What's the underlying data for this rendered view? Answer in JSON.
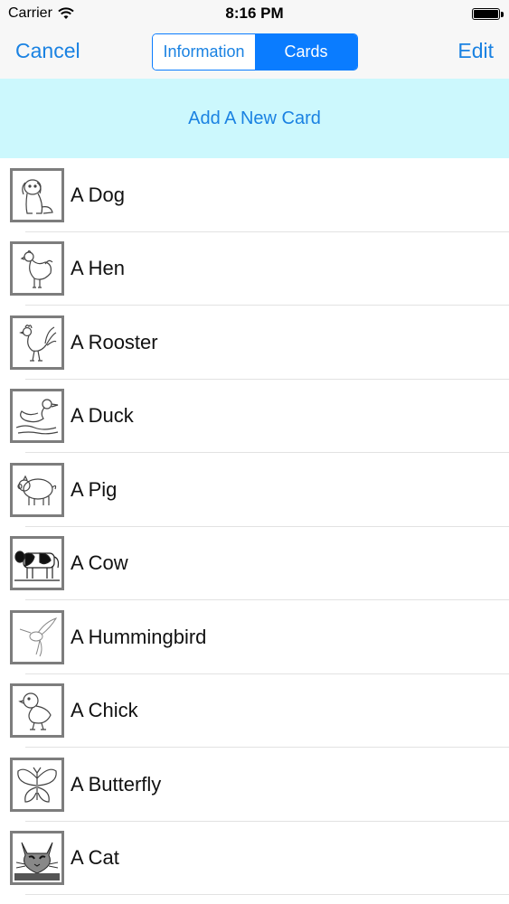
{
  "status_bar": {
    "carrier": "Carrier",
    "time": "8:16 PM"
  },
  "nav": {
    "cancel_label": "Cancel",
    "edit_label": "Edit",
    "segments": [
      "Information",
      "Cards"
    ],
    "selected_segment": "Cards"
  },
  "add_row": {
    "label": "Add A New Card"
  },
  "cards": [
    {
      "label": "A Dog",
      "icon": "dog-icon"
    },
    {
      "label": "A Hen",
      "icon": "hen-icon"
    },
    {
      "label": "A Rooster",
      "icon": "rooster-icon"
    },
    {
      "label": "A Duck",
      "icon": "duck-icon"
    },
    {
      "label": "A Pig",
      "icon": "pig-icon"
    },
    {
      "label": "A Cow",
      "icon": "cow-icon"
    },
    {
      "label": "A Hummingbird",
      "icon": "hummingbird-icon"
    },
    {
      "label": "A Chick",
      "icon": "chick-icon"
    },
    {
      "label": "A Butterfly",
      "icon": "butterfly-icon"
    },
    {
      "label": "A Cat",
      "icon": "cat-icon"
    }
  ],
  "colors": {
    "accent": "#0a7cff",
    "link": "#1a82e2",
    "add_row_bg": "#ccf8fd",
    "bar_bg": "#f7f7f7"
  }
}
